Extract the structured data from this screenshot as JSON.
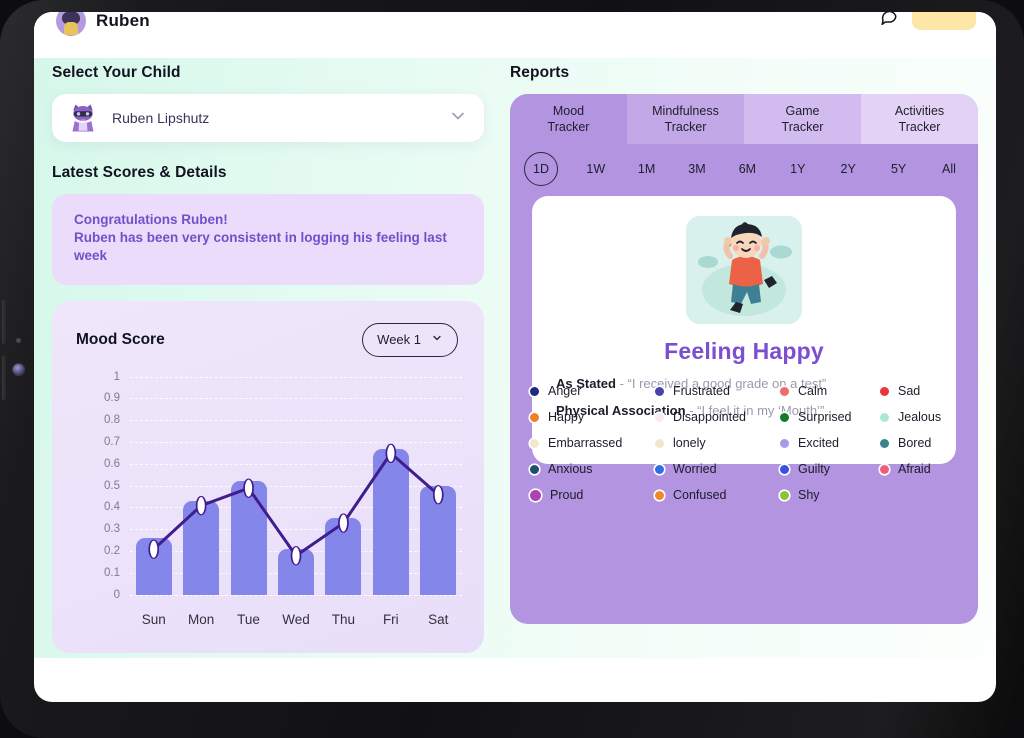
{
  "header": {
    "username": "Ruben",
    "chat_icon": "chat-bubble-icon",
    "cta_label": ""
  },
  "left": {
    "select_child_label": "Select Your Child",
    "child_select": {
      "name": "Ruben Lipshutz",
      "chevron_icon": "chevron-down-icon",
      "avatar_icon": "cat-avatar-icon"
    },
    "latest_scores_label": "Latest Scores & Details",
    "congrats": {
      "title": "Congratulations Ruben!",
      "body": "Ruben has been very consistent in logging his feeling last week"
    },
    "mood_card": {
      "title": "Mood Score",
      "week_selector_label": "Week 1",
      "week_selector_icon": "chevron-down-icon"
    }
  },
  "chart_data": {
    "type": "bar",
    "title": "Mood Score",
    "xlabel": "",
    "ylabel": "",
    "ylim": [
      0,
      1
    ],
    "grid": true,
    "categories": [
      "Sun",
      "Mon",
      "Tue",
      "Wed",
      "Thu",
      "Fri",
      "Sat"
    ],
    "y_ticks": [
      "1",
      "0.9",
      "0.8",
      "0.7",
      "0.6",
      "0.5",
      "0.4",
      "0.3",
      "0.2",
      "0.1",
      "0"
    ],
    "series": [
      {
        "name": "Mood Score (bars)",
        "type": "bar",
        "values": [
          0.26,
          0.43,
          0.52,
          0.21,
          0.35,
          0.67,
          0.5
        ],
        "color": "#8486ea"
      },
      {
        "name": "Mood Score (line)",
        "type": "line",
        "values": [
          0.21,
          0.41,
          0.49,
          0.18,
          0.33,
          0.65,
          0.46
        ],
        "color": "#3f1d8f",
        "marker_color": "#ffffff"
      }
    ]
  },
  "right": {
    "reports_label": "Reports",
    "tracker_tabs": [
      {
        "line1": "Mood",
        "line2": "Tracker",
        "bg": "#b294e0",
        "active": true
      },
      {
        "line1": "Mindfulness",
        "line2": "Tracker",
        "bg": "#c3a8e8",
        "active": false
      },
      {
        "line1": "Game",
        "line2": "Tracker",
        "bg": "#d2bbef",
        "active": false
      },
      {
        "line1": "Activities",
        "line2": "Tracker",
        "bg": "#e4d2f6",
        "active": false
      }
    ],
    "range_tabs": [
      {
        "label": "1D",
        "active": true
      },
      {
        "label": "1W",
        "active": false
      },
      {
        "label": "1M",
        "active": false
      },
      {
        "label": "3M",
        "active": false
      },
      {
        "label": "6M",
        "active": false
      },
      {
        "label": "1Y",
        "active": false
      },
      {
        "label": "2Y",
        "active": false
      },
      {
        "label": "5Y",
        "active": false
      },
      {
        "label": "All",
        "active": false
      }
    ],
    "feeling_card": {
      "illustration_icon": "jumping-happy-boy-illustration",
      "title": "Feeling Happy",
      "details": [
        {
          "label": "As Stated",
          "value": "- “I received a good grade on a test”"
        },
        {
          "label": "Physical Association",
          "value": "- “I feel it in my ‘Mouth’”"
        }
      ]
    },
    "emotions": [
      {
        "label": "Anger",
        "color": "#1c2a80",
        "big": false
      },
      {
        "label": "Frustrated",
        "color": "#4b42ad",
        "big": false
      },
      {
        "label": "Calm",
        "color": "#ef6a6a",
        "big": false
      },
      {
        "label": "Sad",
        "color": "#e8353a",
        "big": false
      },
      {
        "label": "Happy",
        "color": "#f07f2c",
        "big": false
      },
      {
        "label": "Disappointed",
        "color": "#fbe9f2",
        "big": false
      },
      {
        "label": "Surprised",
        "color": "#157a2e",
        "big": false
      },
      {
        "label": "Jealous",
        "color": "#a9e8d8",
        "big": false
      },
      {
        "label": "Embarrassed",
        "color": "#f2e8d2",
        "big": false
      },
      {
        "label": "lonely",
        "color": "#f3e6cd",
        "big": false
      },
      {
        "label": "Excited",
        "color": "#a79aea",
        "big": false
      },
      {
        "label": "Bored",
        "color": "#3d8090",
        "big": false
      },
      {
        "label": "Anxious",
        "color": "#1f4f6e",
        "big": false
      },
      {
        "label": "Worried",
        "color": "#2f6fe0",
        "big": false
      },
      {
        "label": "Guilty",
        "color": "#3a50e0",
        "big": false
      },
      {
        "label": "Afraid",
        "color": "#ef5f7a",
        "big": false
      },
      {
        "label": "Proud",
        "color": "#ab44b0",
        "big": true
      },
      {
        "label": "Confused",
        "color": "#f0892c",
        "big": false
      },
      {
        "label": "Shy",
        "color": "#8fc035",
        "big": false
      }
    ]
  }
}
